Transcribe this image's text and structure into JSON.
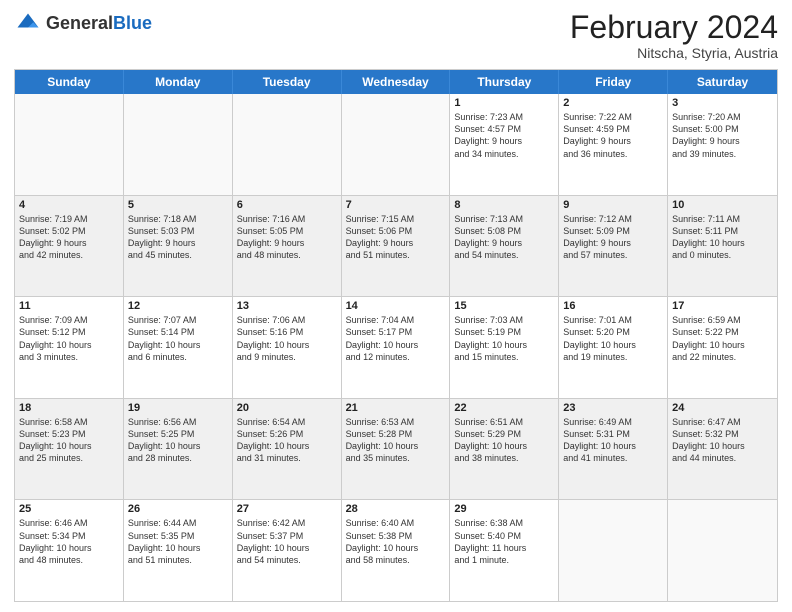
{
  "header": {
    "logo": {
      "general": "General",
      "blue": "Blue"
    },
    "title": "February 2024",
    "location": "Nitscha, Styria, Austria"
  },
  "days_of_week": [
    "Sunday",
    "Monday",
    "Tuesday",
    "Wednesday",
    "Thursday",
    "Friday",
    "Saturday"
  ],
  "weeks": [
    [
      {
        "day": "",
        "info": ""
      },
      {
        "day": "",
        "info": ""
      },
      {
        "day": "",
        "info": ""
      },
      {
        "day": "",
        "info": ""
      },
      {
        "day": "1",
        "info": "Sunrise: 7:23 AM\nSunset: 4:57 PM\nDaylight: 9 hours\nand 34 minutes."
      },
      {
        "day": "2",
        "info": "Sunrise: 7:22 AM\nSunset: 4:59 PM\nDaylight: 9 hours\nand 36 minutes."
      },
      {
        "day": "3",
        "info": "Sunrise: 7:20 AM\nSunset: 5:00 PM\nDaylight: 9 hours\nand 39 minutes."
      }
    ],
    [
      {
        "day": "4",
        "info": "Sunrise: 7:19 AM\nSunset: 5:02 PM\nDaylight: 9 hours\nand 42 minutes."
      },
      {
        "day": "5",
        "info": "Sunrise: 7:18 AM\nSunset: 5:03 PM\nDaylight: 9 hours\nand 45 minutes."
      },
      {
        "day": "6",
        "info": "Sunrise: 7:16 AM\nSunset: 5:05 PM\nDaylight: 9 hours\nand 48 minutes."
      },
      {
        "day": "7",
        "info": "Sunrise: 7:15 AM\nSunset: 5:06 PM\nDaylight: 9 hours\nand 51 minutes."
      },
      {
        "day": "8",
        "info": "Sunrise: 7:13 AM\nSunset: 5:08 PM\nDaylight: 9 hours\nand 54 minutes."
      },
      {
        "day": "9",
        "info": "Sunrise: 7:12 AM\nSunset: 5:09 PM\nDaylight: 9 hours\nand 57 minutes."
      },
      {
        "day": "10",
        "info": "Sunrise: 7:11 AM\nSunset: 5:11 PM\nDaylight: 10 hours\nand 0 minutes."
      }
    ],
    [
      {
        "day": "11",
        "info": "Sunrise: 7:09 AM\nSunset: 5:12 PM\nDaylight: 10 hours\nand 3 minutes."
      },
      {
        "day": "12",
        "info": "Sunrise: 7:07 AM\nSunset: 5:14 PM\nDaylight: 10 hours\nand 6 minutes."
      },
      {
        "day": "13",
        "info": "Sunrise: 7:06 AM\nSunset: 5:16 PM\nDaylight: 10 hours\nand 9 minutes."
      },
      {
        "day": "14",
        "info": "Sunrise: 7:04 AM\nSunset: 5:17 PM\nDaylight: 10 hours\nand 12 minutes."
      },
      {
        "day": "15",
        "info": "Sunrise: 7:03 AM\nSunset: 5:19 PM\nDaylight: 10 hours\nand 15 minutes."
      },
      {
        "day": "16",
        "info": "Sunrise: 7:01 AM\nSunset: 5:20 PM\nDaylight: 10 hours\nand 19 minutes."
      },
      {
        "day": "17",
        "info": "Sunrise: 6:59 AM\nSunset: 5:22 PM\nDaylight: 10 hours\nand 22 minutes."
      }
    ],
    [
      {
        "day": "18",
        "info": "Sunrise: 6:58 AM\nSunset: 5:23 PM\nDaylight: 10 hours\nand 25 minutes."
      },
      {
        "day": "19",
        "info": "Sunrise: 6:56 AM\nSunset: 5:25 PM\nDaylight: 10 hours\nand 28 minutes."
      },
      {
        "day": "20",
        "info": "Sunrise: 6:54 AM\nSunset: 5:26 PM\nDaylight: 10 hours\nand 31 minutes."
      },
      {
        "day": "21",
        "info": "Sunrise: 6:53 AM\nSunset: 5:28 PM\nDaylight: 10 hours\nand 35 minutes."
      },
      {
        "day": "22",
        "info": "Sunrise: 6:51 AM\nSunset: 5:29 PM\nDaylight: 10 hours\nand 38 minutes."
      },
      {
        "day": "23",
        "info": "Sunrise: 6:49 AM\nSunset: 5:31 PM\nDaylight: 10 hours\nand 41 minutes."
      },
      {
        "day": "24",
        "info": "Sunrise: 6:47 AM\nSunset: 5:32 PM\nDaylight: 10 hours\nand 44 minutes."
      }
    ],
    [
      {
        "day": "25",
        "info": "Sunrise: 6:46 AM\nSunset: 5:34 PM\nDaylight: 10 hours\nand 48 minutes."
      },
      {
        "day": "26",
        "info": "Sunrise: 6:44 AM\nSunset: 5:35 PM\nDaylight: 10 hours\nand 51 minutes."
      },
      {
        "day": "27",
        "info": "Sunrise: 6:42 AM\nSunset: 5:37 PM\nDaylight: 10 hours\nand 54 minutes."
      },
      {
        "day": "28",
        "info": "Sunrise: 6:40 AM\nSunset: 5:38 PM\nDaylight: 10 hours\nand 58 minutes."
      },
      {
        "day": "29",
        "info": "Sunrise: 6:38 AM\nSunset: 5:40 PM\nDaylight: 11 hours\nand 1 minute."
      },
      {
        "day": "",
        "info": ""
      },
      {
        "day": "",
        "info": ""
      }
    ]
  ]
}
